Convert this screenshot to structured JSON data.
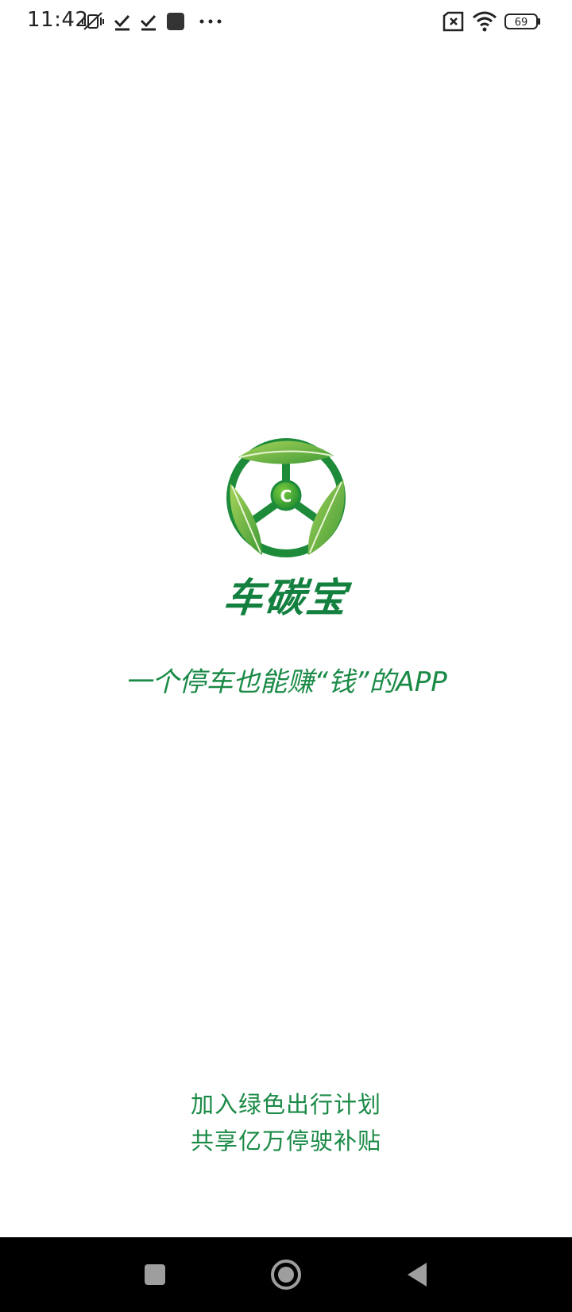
{
  "status_bar": {
    "time": "11:42",
    "battery_level": "69",
    "icons": [
      "mute-vibrate-icon",
      "check-icon",
      "check-icon",
      "app-square-icon",
      "more-dots-icon",
      "no-sim-icon",
      "wifi-icon",
      "battery-icon"
    ]
  },
  "splash": {
    "logo_letter": "C",
    "brand_name": "车碳宝",
    "tagline": "一个停车也能赚“钱”的APP",
    "footer_line1": "加入绿色出行计划",
    "footer_line2": "共享亿万停驶补贴"
  },
  "nav_bar": {
    "buttons": [
      "recent-apps",
      "home",
      "back"
    ]
  },
  "colors": {
    "brand_green": "#13803f",
    "text_green": "#1a8a46",
    "leaf_light": "#8cc34a",
    "leaf_dark": "#3f9a35",
    "nav_bg": "#000000"
  }
}
